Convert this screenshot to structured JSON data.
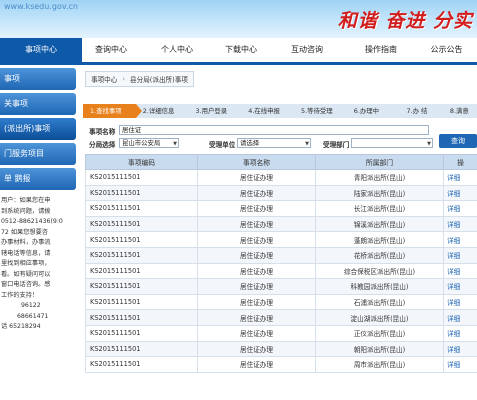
{
  "banner": {
    "url_text": "www.ksedu.gov.cn",
    "slogan": "和谐 奋进 分实"
  },
  "nav": {
    "items": [
      {
        "label": "事项中心",
        "active": true
      },
      {
        "label": "查询中心"
      },
      {
        "label": "个人中心"
      },
      {
        "label": "下载中心"
      },
      {
        "label": "互动咨询"
      },
      {
        "label": "操作指南"
      },
      {
        "label": "公示公告"
      }
    ]
  },
  "sidebar": {
    "items": [
      {
        "label": "事项"
      },
      {
        "label": "关事项"
      },
      {
        "label": "(派出所)事项",
        "current": true
      },
      {
        "label": "门服务项目"
      },
      {
        "label": "单 鹅报"
      }
    ],
    "notice_lines": [
      "用户：如果您在申",
      "到系统问题，请拨",
      "0512-88621436(9:0",
      "72 如果您想要咨",
      "办事材料，办事流",
      "辖电话等信息，请",
      "里找到相应事项，",
      "看。如有疑问可以",
      "窗口电话咨询。感",
      "工作的支持！",
      "96122",
      "68661471",
      "话  65218294"
    ]
  },
  "breadcrumb": {
    "items": [
      "事项中心",
      "县分局(派出所)事项"
    ]
  },
  "steps": [
    {
      "label": "1.查找事项",
      "active": true
    },
    {
      "label": "2.详细信息"
    },
    {
      "label": "3.用户登录"
    },
    {
      "label": "4.在线申报"
    },
    {
      "label": "5.等待受理"
    },
    {
      "label": "6.办理中"
    },
    {
      "label": "7.办 结"
    },
    {
      "label": "8.满意"
    }
  ],
  "filter": {
    "name_label": "事项名称",
    "name_value": "居住证",
    "category_label": "分局选择",
    "category_value": "昆山市公安局",
    "unit_label": "受理单位",
    "unit_value": "请选择",
    "dept_label": "受理部门",
    "dept_value": "",
    "query_button": "查询"
  },
  "table": {
    "headers": [
      "事项编码",
      "事项名称",
      "所属部门",
      "操"
    ],
    "rows": [
      {
        "code": "KS2015111501",
        "name": "居住证办理",
        "dept": "青阳派出所(昆山)",
        "op": "详细"
      },
      {
        "code": "KS2015111501",
        "name": "居住证办理",
        "dept": "陆家派出所(昆山)",
        "op": "详细"
      },
      {
        "code": "KS2015111501",
        "name": "居住证办理",
        "dept": "长江派出所(昆山)",
        "op": "详细"
      },
      {
        "code": "KS2015111501",
        "name": "居住证办理",
        "dept": "锦溪派出所(昆山)",
        "op": "详细"
      },
      {
        "code": "KS2015111501",
        "name": "居住证办理",
        "dept": "蓬朗派出所(昆山)",
        "op": "详细"
      },
      {
        "code": "KS2015111501",
        "name": "居住证办理",
        "dept": "花桥派出所(昆山)",
        "op": "详细"
      },
      {
        "code": "KS2015111501",
        "name": "居住证办理",
        "dept": "综合保税区派出所(昆山)",
        "op": "详细"
      },
      {
        "code": "KS2015111501",
        "name": "居住证办理",
        "dept": "科教园派出所(昆山)",
        "op": "详细"
      },
      {
        "code": "KS2015111501",
        "name": "居住证办理",
        "dept": "石浦派出所(昆山)",
        "op": "详细"
      },
      {
        "code": "KS2015111501",
        "name": "居住证办理",
        "dept": "淀山湖派出所(昆山)",
        "op": "详细"
      },
      {
        "code": "KS2015111501",
        "name": "居住证办理",
        "dept": "正仪派出所(昆山)",
        "op": "详细"
      },
      {
        "code": "KS2015111501",
        "name": "居住证办理",
        "dept": "朝阳派出所(昆山)",
        "op": "详细"
      },
      {
        "code": "KS2015111501",
        "name": "居住证办理",
        "dept": "周市派出所(昆山)",
        "op": "详细"
      }
    ]
  }
}
